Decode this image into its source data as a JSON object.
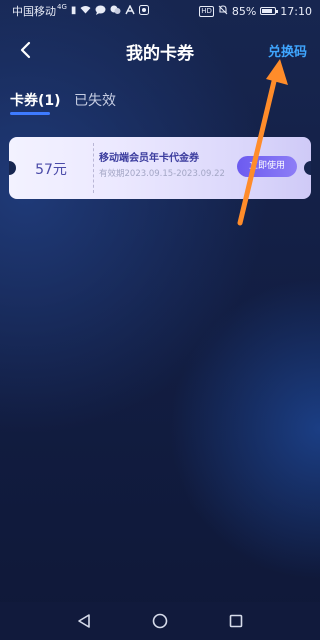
{
  "status_bar": {
    "carrier": "中国移动",
    "signal_label": "4G",
    "battery": "85%",
    "battery_level": 0.85,
    "time": "17:10",
    "hd": "HD"
  },
  "header": {
    "title": "我的卡券",
    "redeem_label": "兑换码"
  },
  "tabs": [
    {
      "label": "卡券(1)",
      "active": true
    },
    {
      "label": "已失效",
      "active": false
    }
  ],
  "coupon": {
    "amount": "57元",
    "name": "移动端会员年卡代金券",
    "validity": "有效期2023.09.15-2023.09.22",
    "button_label": "立即使用"
  },
  "colors": {
    "accent": "#3fa6ff",
    "button": "#6c5bf0",
    "annotation": "#ff8c2a"
  }
}
